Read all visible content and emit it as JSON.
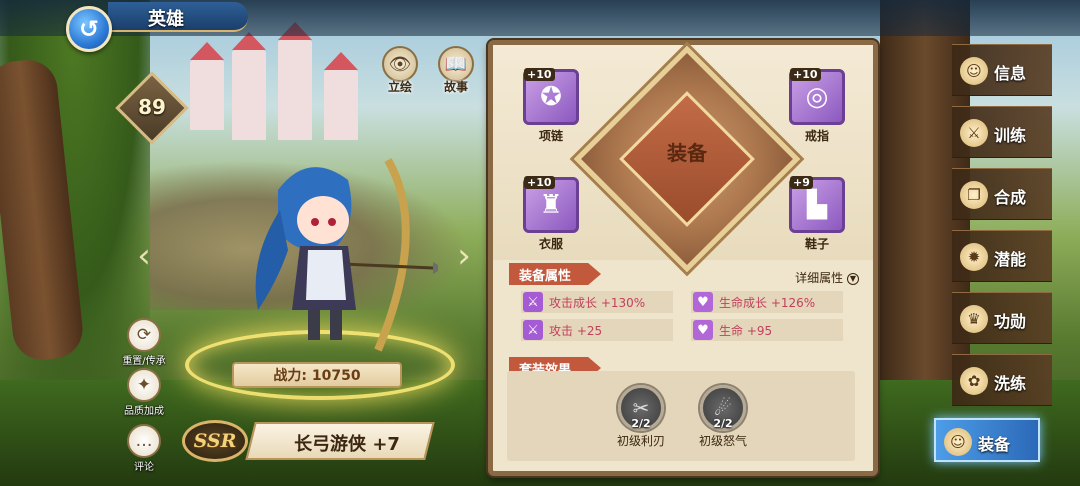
{
  "header": {
    "title": "英雄",
    "back_icon": "back-arrow-icon"
  },
  "hero": {
    "level": "89",
    "top_actions": [
      {
        "label": "立绘",
        "icon": "eye-icon"
      },
      {
        "label": "故事",
        "icon": "book-icon"
      }
    ],
    "side_actions": [
      {
        "label": "重置/传承",
        "icon": "reset-icon"
      },
      {
        "label": "品质加成",
        "icon": "flame-icon"
      },
      {
        "label": "评论",
        "icon": "chat-bubble-icon"
      }
    ],
    "power": "战力: 10750",
    "rarity": "SSR",
    "name": "长弓游侠 +7"
  },
  "equipment": {
    "title": "装备",
    "slots": [
      {
        "level": "+10",
        "name": "项链",
        "icon": "necklace-icon"
      },
      {
        "level": "+10",
        "name": "戒指",
        "icon": "ring-icon"
      },
      {
        "level": "+10",
        "name": "衣服",
        "icon": "armor-icon"
      },
      {
        "level": "+9",
        "name": "鞋子",
        "icon": "boots-icon"
      }
    ],
    "attributes_heading": "装备属性",
    "detail_label": "详细属性",
    "attributes": [
      {
        "text": "攻击成长 +130%",
        "icon": "sword-icon"
      },
      {
        "text": "生命成长 +126%",
        "icon": "heart-icon"
      },
      {
        "text": "攻击 +25",
        "icon": "sword-icon"
      },
      {
        "text": "生命 +95",
        "icon": "heart-icon"
      }
    ],
    "set_heading": "套装效果",
    "sets": [
      {
        "count": "2/2",
        "name": "初级利刃",
        "icon": "blade-set-icon"
      },
      {
        "count": "2/2",
        "name": "初级怒气",
        "icon": "rage-set-icon"
      }
    ]
  },
  "right_nav": [
    {
      "label": "信息",
      "icon": "info-icon",
      "active": false
    },
    {
      "label": "训练",
      "icon": "training-icon",
      "active": false
    },
    {
      "label": "合成",
      "icon": "compose-icon",
      "active": false
    },
    {
      "label": "潜能",
      "icon": "potential-icon",
      "active": false
    },
    {
      "label": "功勋",
      "icon": "merit-icon",
      "active": false
    },
    {
      "label": "洗练",
      "icon": "refine-icon",
      "active": false
    },
    {
      "label": "装备",
      "icon": "equipment-icon",
      "active": true
    }
  ]
}
